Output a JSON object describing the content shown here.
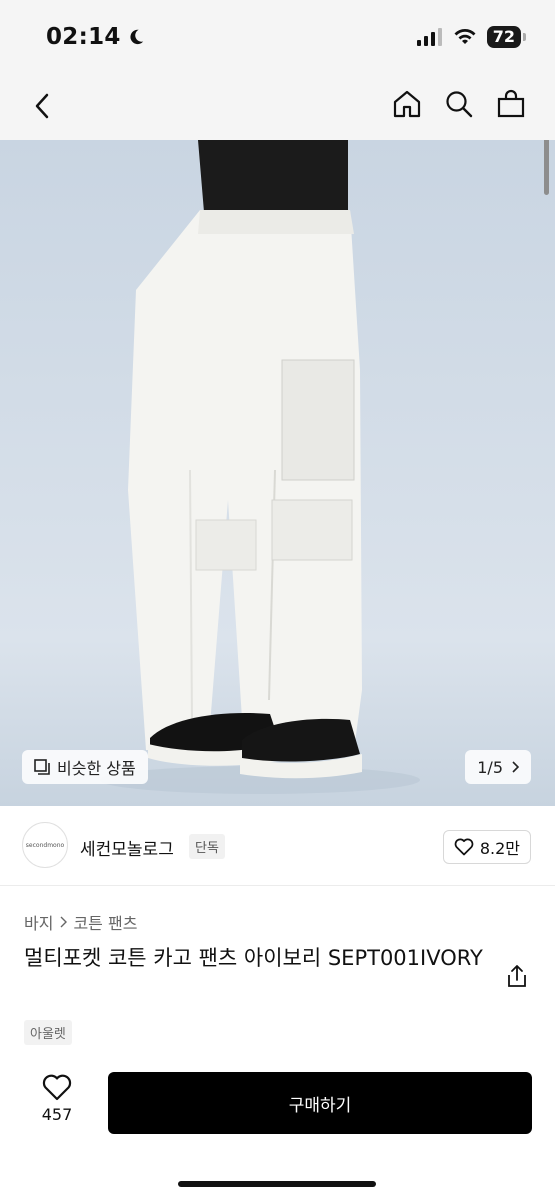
{
  "status_bar": {
    "time": "02:14",
    "battery": "72"
  },
  "nav": {
    "back_icon": "chevron-left-icon",
    "home_icon": "home-icon",
    "search_icon": "search-icon",
    "cart_icon": "shopping-bag-icon"
  },
  "image": {
    "similar_label": "비슷한 상품",
    "pager": "1/5"
  },
  "store": {
    "logo_text": "secondmono",
    "name": "세컨모놀로그",
    "badge": "단독",
    "like_count": "8.2만"
  },
  "product": {
    "breadcrumb": [
      "바지",
      "코튼 팬츠"
    ],
    "title": "멀티포켓 코튼 카고 팬츠 아이보리 SEPT001IVORY",
    "tag": "아울렛"
  },
  "bottom": {
    "wish_count": "457",
    "buy_label": "구매하기"
  },
  "colors": {
    "buy_button": "#000000",
    "background": "#ffffff",
    "header": "#f5f5f5"
  }
}
